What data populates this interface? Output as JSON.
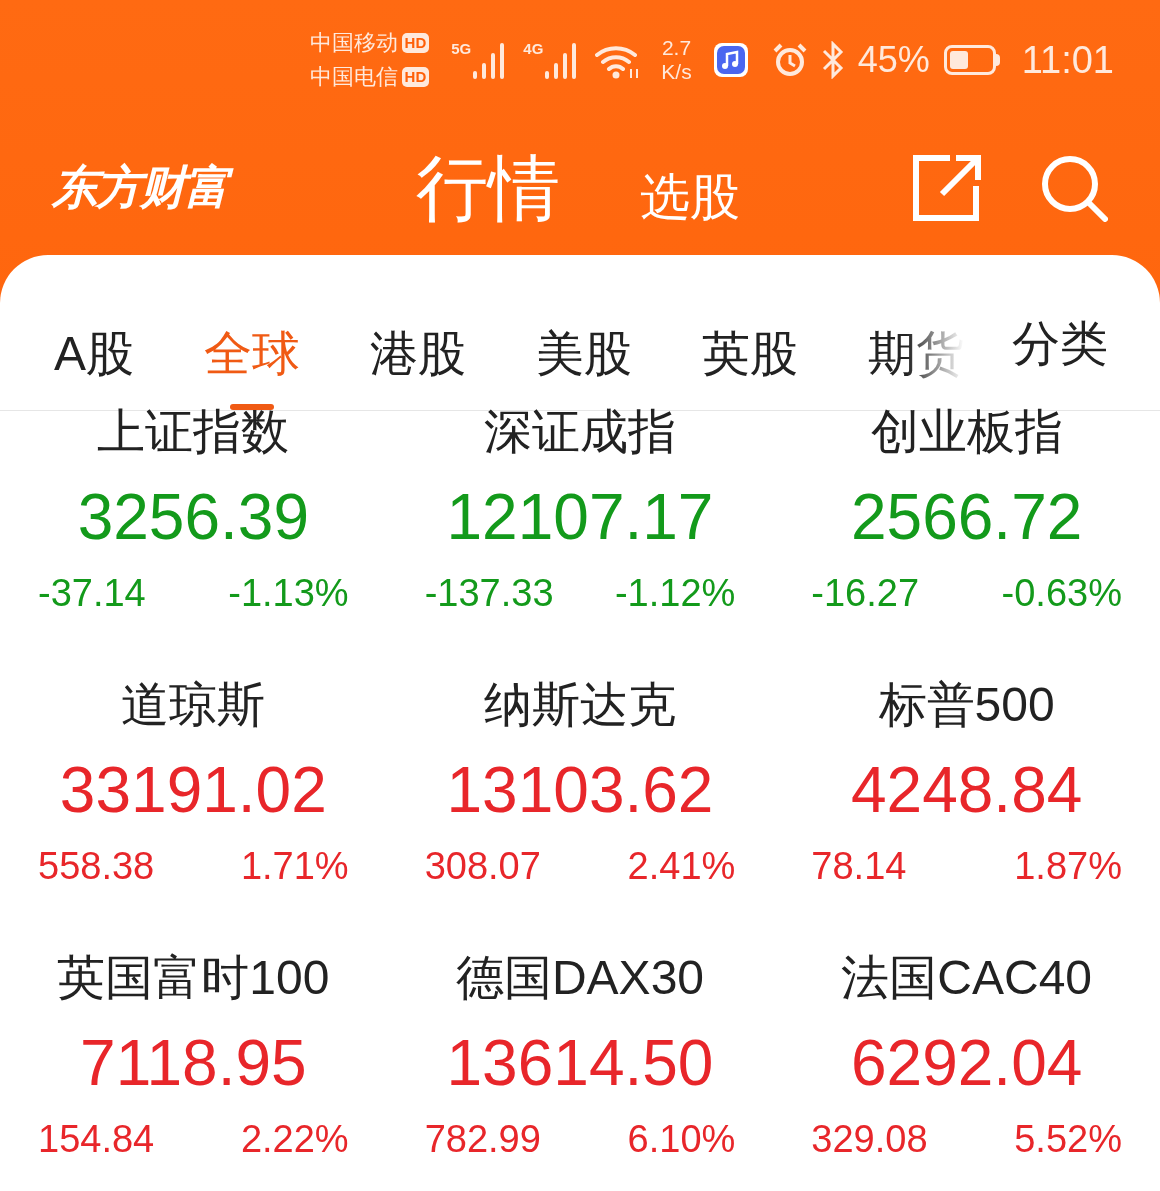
{
  "status_bar": {
    "carriers": [
      {
        "name": "中国移动",
        "badge": "HD"
      },
      {
        "name": "中国电信",
        "badge": "HD"
      }
    ],
    "signals": [
      {
        "label": "5G"
      },
      {
        "label": "4G"
      }
    ],
    "speed": [
      "2.7",
      "K/s"
    ],
    "battery_text": "45%",
    "time": "11:01"
  },
  "header": {
    "logo": "东方财富",
    "tabs": [
      {
        "label": "行情",
        "selected": true
      },
      {
        "label": "选股",
        "selected": false
      }
    ]
  },
  "market_tabs": [
    {
      "label": "A股",
      "selected": false,
      "faded": false
    },
    {
      "label": "全球",
      "selected": true,
      "faded": false
    },
    {
      "label": "港股",
      "selected": false,
      "faded": false
    },
    {
      "label": "美股",
      "selected": false,
      "faded": false
    },
    {
      "label": "英股",
      "selected": false,
      "faded": false
    },
    {
      "label": "期货",
      "selected": false,
      "faded": true
    }
  ],
  "category_button": "分类",
  "quotes": [
    {
      "name": "上证指数",
      "value": "3256.39",
      "change": "-37.14",
      "percent": "-1.13%",
      "rising": false
    },
    {
      "name": "深证成指",
      "value": "12107.17",
      "change": "-137.33",
      "percent": "-1.12%",
      "rising": false
    },
    {
      "name": "创业板指",
      "value": "2566.72",
      "change": "-16.27",
      "percent": "-0.63%",
      "rising": false
    },
    {
      "name": "道琼斯",
      "value": "33191.02",
      "change": "558.38",
      "percent": "1.71%",
      "rising": true
    },
    {
      "name": "纳斯达克",
      "value": "13103.62",
      "change": "308.07",
      "percent": "2.41%",
      "rising": true
    },
    {
      "name": "标普500",
      "value": "4248.84",
      "change": "78.14",
      "percent": "1.87%",
      "rising": true
    },
    {
      "name": "英国富时100",
      "value": "7118.95",
      "change": "154.84",
      "percent": "2.22%",
      "rising": true
    },
    {
      "name": "德国DAX30",
      "value": "13614.50",
      "change": "782.99",
      "percent": "6.10%",
      "rising": true
    },
    {
      "name": "法国CAC40",
      "value": "6292.04",
      "change": "329.08",
      "percent": "5.52%",
      "rising": true
    }
  ]
}
